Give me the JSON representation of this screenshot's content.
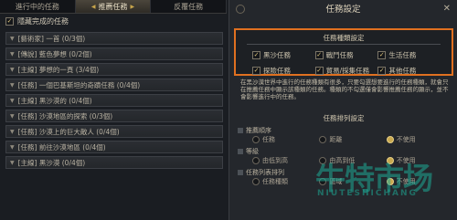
{
  "tabs": [
    {
      "label": "進行中的任務"
    },
    {
      "label": "推薦任務"
    },
    {
      "label": "反覆任務"
    }
  ],
  "hide_completed": {
    "label": "隱藏完成的任務",
    "checked": true
  },
  "quests": [
    {
      "title": "[藝術家] 一首 (0/3個)"
    },
    {
      "title": "[傳說] 藍色夢想 (0/2個)"
    },
    {
      "title": "[主線] 夢想的一頁 (3/4個)"
    },
    {
      "title": "[任務] 一個巴基斯坦的奇蹟任務 (0/4個)"
    },
    {
      "title": "[主線] 黑沙漠的 (0/4個)"
    },
    {
      "title": "[任務] 沙漠地區的探索 (0/3個)"
    },
    {
      "title": "[任務] 沙漠上的巨大敵人 (0/4個)"
    },
    {
      "title": "[任務] 前往沙漠地區 (0/4個)"
    },
    {
      "title": "[主線] 黑沙漠 (0/4個)"
    }
  ],
  "panel": {
    "title": "任務設定",
    "close": "✕"
  },
  "settings": {
    "title": "任務種類設定",
    "items": [
      {
        "label": "黑沙任務",
        "checked": true
      },
      {
        "label": "戰鬥任務",
        "checked": true
      },
      {
        "label": "生活任務",
        "checked": true
      },
      {
        "label": "探險任務",
        "checked": true
      },
      {
        "label": "貿易/採集任務",
        "checked": true
      },
      {
        "label": "其他任務",
        "checked": true
      }
    ]
  },
  "description": "在黑沙漠世界中進行的任務種類有很多，只要勾選想要進行的任務種類，就會只在推薦任務中顯示該種類的任務。種類的不勾選僅會影響推薦任務的顯示，並不會影響進行中的任務。",
  "order": {
    "title": "任務排列設定",
    "groups": [
      {
        "label": "推薦順序",
        "options": [
          {
            "label": "任務",
            "selected": false
          },
          {
            "label": "距離",
            "selected": false
          },
          {
            "label": "不使用",
            "selected": true
          }
        ]
      },
      {
        "label": "等級",
        "options": [
          {
            "label": "由低到高",
            "selected": false
          },
          {
            "label": "由高到低",
            "selected": false
          },
          {
            "label": "不使用",
            "selected": true
          }
        ]
      },
      {
        "label": "任務列表排列",
        "options": [
          {
            "label": "任務種類",
            "selected": false
          },
          {
            "label": "區域",
            "selected": false
          },
          {
            "label": "不使用",
            "selected": true
          }
        ]
      }
    ]
  },
  "watermark": {
    "main": "牛特市场",
    "sub": "NIUTESHICHANG"
  }
}
